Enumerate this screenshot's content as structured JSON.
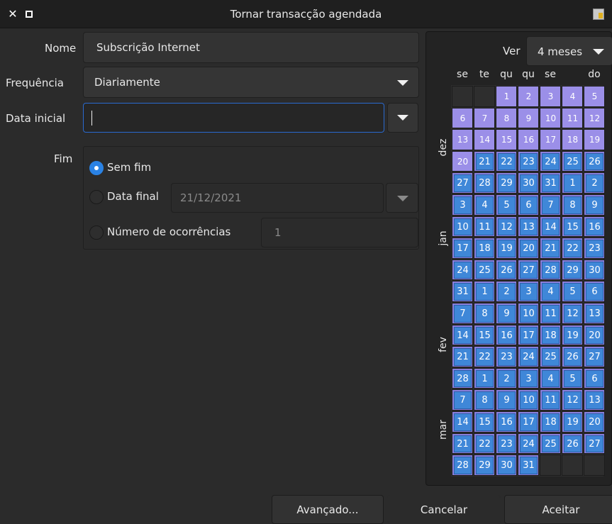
{
  "window": {
    "title": "Tornar transacção agendada"
  },
  "form": {
    "name_label": "Nome",
    "name_value": "Subscrição Internet",
    "frequency_label": "Frequência",
    "frequency_value": "Diariamente",
    "start_date_label": "Data inicial",
    "start_date_value": "",
    "end_label": "Fim"
  },
  "end_options": {
    "no_end_label": "Sem fim",
    "end_date_label": "Data final",
    "end_date_value": "21/12/2021",
    "occurrences_label": "Número de ocorrências",
    "occurrences_value": "1",
    "selected": "no_end"
  },
  "calendar": {
    "view_label": "Ver",
    "view_value": "4 meses",
    "day_headers": [
      "se",
      "te",
      "qu",
      "qu",
      "se",
      "",
      "do"
    ],
    "months": [
      "dez",
      "jan",
      "fev",
      "mar"
    ],
    "rows": [
      [
        "",
        "",
        "1",
        "2",
        "3",
        "4",
        "5"
      ],
      [
        "6",
        "7",
        "8",
        "9",
        "10",
        "11",
        "12"
      ],
      [
        "13",
        "14",
        "15",
        "16",
        "17",
        "18",
        "19"
      ],
      [
        "20",
        "21",
        "22",
        "23",
        "24",
        "25",
        "26"
      ],
      [
        "27",
        "28",
        "29",
        "30",
        "31",
        "1",
        "2"
      ],
      [
        "3",
        "4",
        "5",
        "6",
        "7",
        "8",
        "9"
      ],
      [
        "10",
        "11",
        "12",
        "13",
        "14",
        "15",
        "16"
      ],
      [
        "17",
        "18",
        "19",
        "20",
        "21",
        "22",
        "23"
      ],
      [
        "24",
        "25",
        "26",
        "27",
        "28",
        "29",
        "30"
      ],
      [
        "31",
        "1",
        "2",
        "3",
        "4",
        "5",
        "6"
      ],
      [
        "7",
        "8",
        "9",
        "10",
        "11",
        "12",
        "13"
      ],
      [
        "14",
        "15",
        "16",
        "17",
        "18",
        "19",
        "20"
      ],
      [
        "21",
        "22",
        "23",
        "24",
        "25",
        "26",
        "27"
      ],
      [
        "28",
        "1",
        "2",
        "3",
        "4",
        "5",
        "6"
      ],
      [
        "7",
        "8",
        "9",
        "10",
        "11",
        "12",
        "13"
      ],
      [
        "14",
        "15",
        "16",
        "17",
        "18",
        "19",
        "20"
      ],
      [
        "21",
        "22",
        "23",
        "24",
        "25",
        "26",
        "27"
      ],
      [
        "28",
        "29",
        "30",
        "31",
        "",
        "",
        ""
      ]
    ],
    "colors": {
      "purple": "#9b8fe8",
      "blue": "#3f87d8",
      "blue_border": "#2a5fa8",
      "purple_border": "#7d6fd0"
    }
  },
  "buttons": {
    "advanced": "Avançado...",
    "cancel": "Cancelar",
    "accept": "Aceitar"
  },
  "colors": {
    "accent": "#2a82e4",
    "background": "#2b2b2b"
  },
  "icons": [
    "close-icon",
    "maximize-icon",
    "app-icon",
    "chevron-down-icon",
    "radio-icon"
  ]
}
